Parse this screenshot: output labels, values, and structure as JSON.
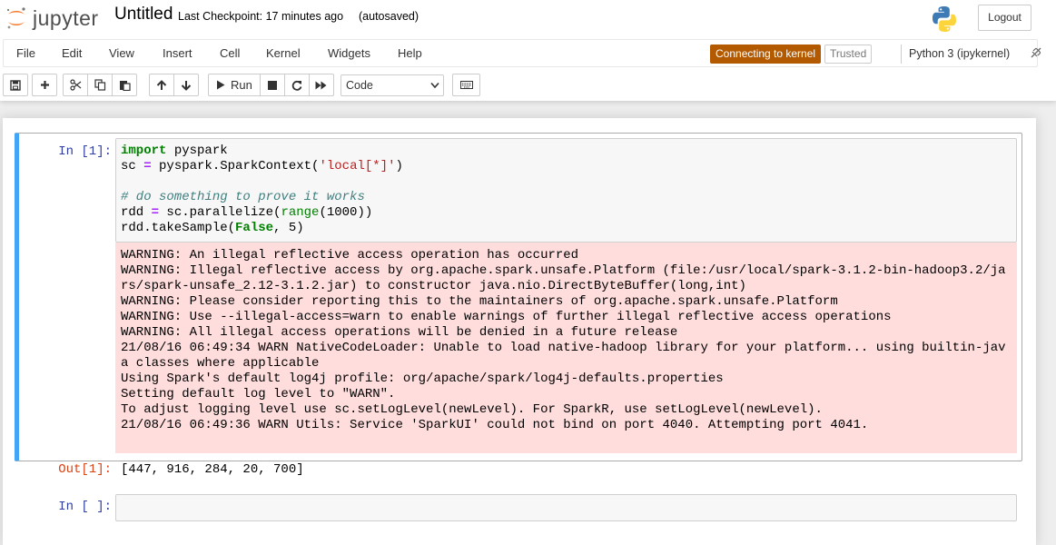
{
  "header": {
    "logo_text": "jupyter",
    "notebook_title": "Untitled",
    "checkpoint": "Last Checkpoint: 17 minutes ago",
    "autosave_status": "(autosaved)",
    "logout_label": "Logout"
  },
  "menubar": {
    "items": [
      "File",
      "Edit",
      "View",
      "Insert",
      "Cell",
      "Kernel",
      "Widgets",
      "Help"
    ],
    "kernel_status": "Connecting to kernel",
    "trusted_label": "Trusted",
    "kernel_name": "Python 3 (ipykernel)"
  },
  "toolbar": {
    "run_label": "Run",
    "cell_type": "Code",
    "icons": [
      "save-icon",
      "plus-icon",
      "cut-icon",
      "copy-icon",
      "paste-icon",
      "arrow-up-icon",
      "arrow-down-icon",
      "play-icon",
      "stop-icon",
      "restart-icon",
      "fast-forward-icon",
      "keyboard-icon"
    ]
  },
  "cells": {
    "cell1": {
      "in_prompt": "In [1]:",
      "code": {
        "l1_kw": "import",
        "l1_rest": " pyspark",
        "l2_a": "sc ",
        "l2_op": "=",
        "l2_b": " pyspark.SparkContext(",
        "l2_str": "'local[*]'",
        "l2_c": ")",
        "l4_cmt": "# do something to prove it works",
        "l5_a": "rdd ",
        "l5_op": "=",
        "l5_b": " sc.parallelize(",
        "l5_bi": "range",
        "l5_c": "(1000))",
        "l6_a": "rdd.takeSample(",
        "l6_kw": "False",
        "l6_b": ", 5)"
      },
      "stderr": [
        "WARNING: An illegal reflective access operation has occurred",
        "WARNING: Illegal reflective access by org.apache.spark.unsafe.Platform (file:/usr/local/spark-3.1.2-bin-hadoop3.2/ja",
        "rs/spark-unsafe_2.12-3.1.2.jar) to constructor java.nio.DirectByteBuffer(long,int)",
        "WARNING: Please consider reporting this to the maintainers of org.apache.spark.unsafe.Platform",
        "WARNING: Use --illegal-access=warn to enable warnings of further illegal reflective access operations",
        "WARNING: All illegal access operations will be denied in a future release",
        "21/08/16 06:49:34 WARN NativeCodeLoader: Unable to load native-hadoop library for your platform... using builtin-jav",
        "a classes where applicable",
        "Using Spark's default log4j profile: org/apache/spark/log4j-defaults.properties",
        "Setting default log level to \"WARN\".",
        "To adjust logging level use sc.setLogLevel(newLevel). For SparkR, use setLogLevel(newLevel).",
        "21/08/16 06:49:36 WARN Utils: Service 'SparkUI' could not bind on port 4040. Attempting port 4041."
      ],
      "out_prompt": "Out[1]:",
      "output": "[447, 916, 284, 20, 700]"
    },
    "cell2": {
      "in_prompt": "In [ ]:"
    }
  },
  "colors": {
    "kernel_status_bg": "#b35900",
    "selected_cell_bar": "#42a5f5",
    "stderr_bg": "#ffdddd",
    "in_prompt": "#303f9f",
    "out_prompt": "#d84315"
  }
}
